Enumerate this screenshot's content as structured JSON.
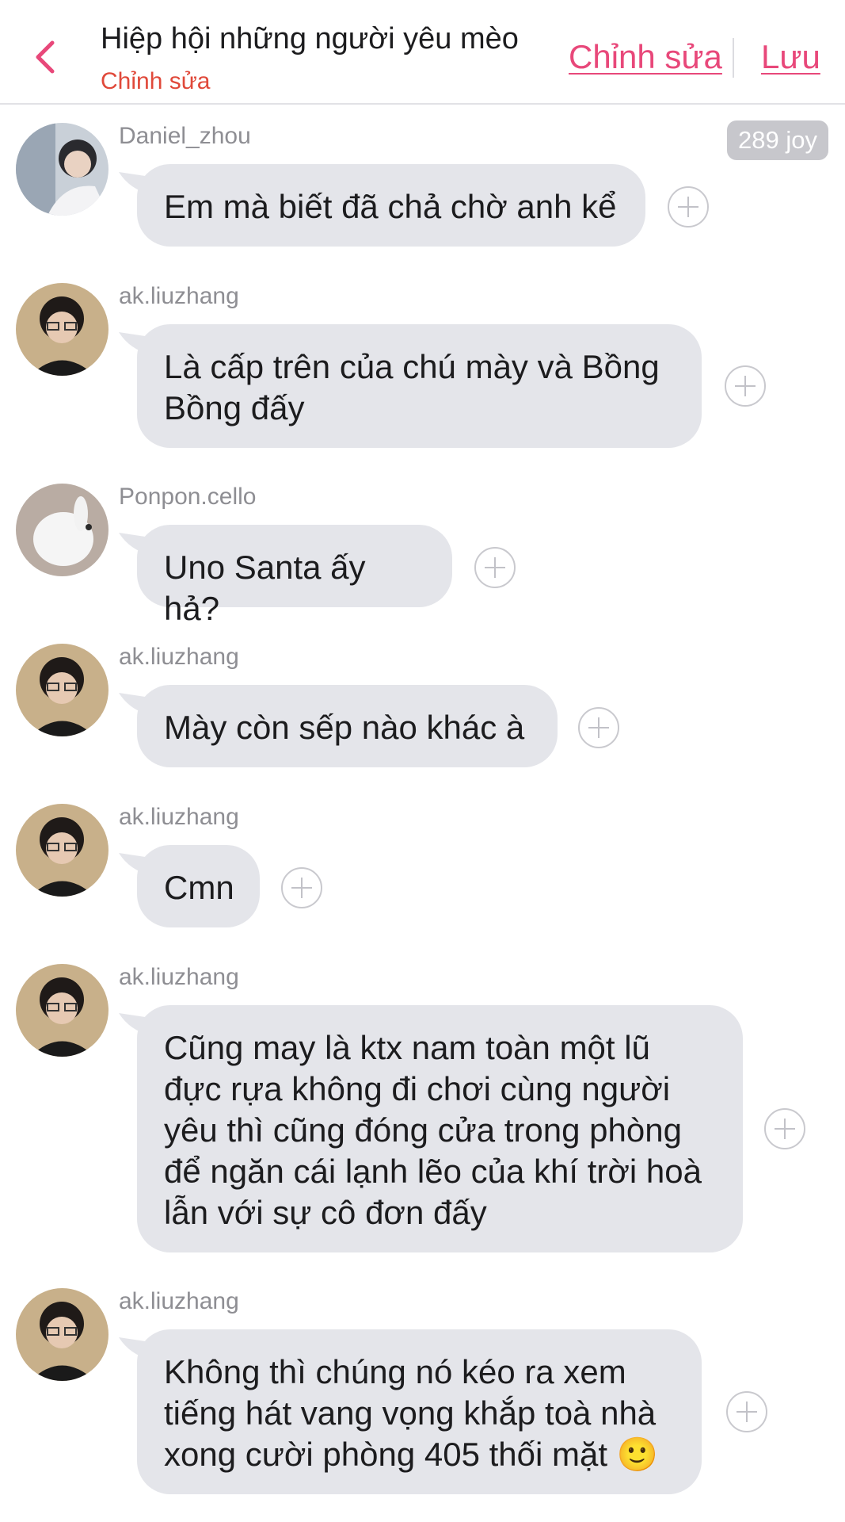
{
  "header": {
    "title": "Hiệp hội những người yêu mèo",
    "subtitle": "Chỉnh sửa",
    "edit_label": "Chỉnh sửa",
    "save_label": "Lưu"
  },
  "badge": {
    "joy": "289 joy"
  },
  "messages": [
    {
      "user": "Daniel_zhou",
      "text": "Em mà biết đã chả chờ anh kể"
    },
    {
      "user": "ak.liuzhang",
      "text": "Là cấp trên của chú mày và Bồng Bồng đấy"
    },
    {
      "user": "Ponpon.cello",
      "text": "Uno Santa ấy hả?"
    },
    {
      "user": "ak.liuzhang",
      "text": "Mày còn sếp nào khác à"
    },
    {
      "user": "ak.liuzhang",
      "text": "Cmn"
    },
    {
      "user": "ak.liuzhang",
      "text": "Cũng may là ktx nam toàn một lũ đực rựa không đi chơi cùng người yêu thì cũng đóng cửa trong phòng để ngăn cái lạnh lẽo của khí trời hoà lẫn với sự cô đơn đấy"
    },
    {
      "user": "ak.liuzhang",
      "text": "Không thì chúng nó kéo ra xem tiếng hát vang vọng khắp toà nhà xong cười phòng 405 thối mặt 🙂"
    }
  ],
  "colors": {
    "accent": "#e8487a",
    "subtitle": "#e0493a",
    "bubble": "#e4e5ea"
  }
}
